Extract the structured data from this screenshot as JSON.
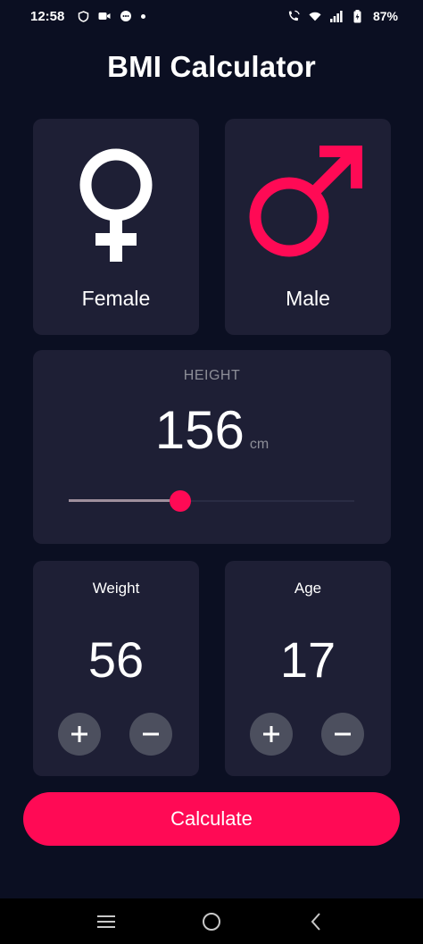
{
  "status_bar": {
    "time": "12:58",
    "battery": "87%",
    "icons": [
      "shield-icon",
      "video-icon",
      "chat-icon",
      "dot-icon",
      "wifi-call-icon",
      "wifi-icon",
      "signal-icon",
      "battery-icon"
    ]
  },
  "app": {
    "title": "BMI Calculator"
  },
  "gender": {
    "female_label": "Female",
    "male_label": "Male",
    "female_color": "#ffffff",
    "male_color": "#ff0a55"
  },
  "height": {
    "label": "HEIGHT",
    "value": "156",
    "unit": "cm",
    "slider_fraction": 0.39
  },
  "weight": {
    "label": "Weight",
    "value": "56"
  },
  "age": {
    "label": "Age",
    "value": "17"
  },
  "actions": {
    "calculate_label": "Calculate"
  },
  "colors": {
    "background": "#0b0f22",
    "card": "#1e1f35",
    "accent": "#ff0a55",
    "muted_text": "#8d8e98",
    "button": "#4c4f5e"
  },
  "nav": {
    "icons": [
      "menu-icon",
      "home-icon",
      "back-icon"
    ]
  }
}
